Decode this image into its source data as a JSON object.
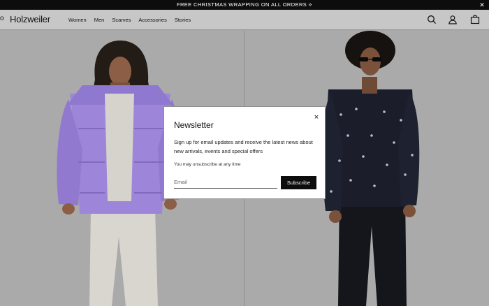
{
  "promo": {
    "text": "FREE CHRISTMAS WRAPPING ON ALL ORDERS ⟡",
    "close_label": "✕"
  },
  "header": {
    "logo_partial": "o",
    "logo": "Holzweiler",
    "nav": [
      "Women",
      "Men",
      "Scarves",
      "Accessories",
      "Stories"
    ],
    "icons": [
      "search-icon",
      "account-icon",
      "cart-icon"
    ]
  },
  "hero": {
    "left": {
      "image": "model-purple-puffer-jacket"
    },
    "right": {
      "image": "model-black-patterned-jacket"
    }
  },
  "newsletter": {
    "title": "Newsletter",
    "close_label": "×",
    "description": "Sign up for email updates and receive the latest news about new arrivals, events and special offers",
    "note": "You may unsubscribe at any time",
    "email_placeholder": "Email",
    "email_value": "",
    "subscribe_label": "Subscribe"
  },
  "colors": {
    "promo_bg": "#0d0d0d",
    "header_bg": "#c7c7c7",
    "hero_bg": "#aaaaaa",
    "jacket_purple": "#9d86d9",
    "button_bg": "#0d0d0d"
  }
}
